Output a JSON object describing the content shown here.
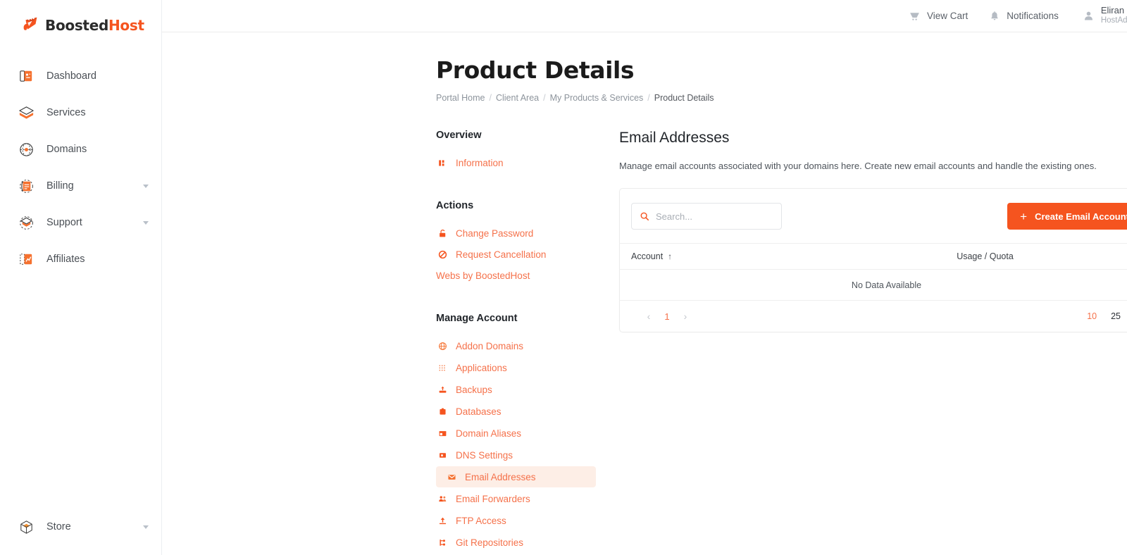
{
  "brand": {
    "name_part1": "Boosted",
    "name_part2": "Host",
    "accent": "#f5541f",
    "accent_light": "#f5714a",
    "highlight_bg": "#fdeee6"
  },
  "sidebar": {
    "items": [
      {
        "label": "Dashboard",
        "icon": "dashboard-icon",
        "caret": false
      },
      {
        "label": "Services",
        "icon": "services-box-icon",
        "caret": false
      },
      {
        "label": "Domains",
        "icon": "domains-globe-icon",
        "caret": false
      },
      {
        "label": "Billing",
        "icon": "billing-icon",
        "caret": true
      },
      {
        "label": "Support",
        "icon": "support-icon",
        "caret": true
      },
      {
        "label": "Affiliates",
        "icon": "affiliates-icon",
        "caret": false
      }
    ],
    "bottom": {
      "label": "Store",
      "icon": "store-cube-icon",
      "caret": true
    }
  },
  "topbar": {
    "cart": {
      "label": "View Cart",
      "icon": "cart-icon"
    },
    "notifications": {
      "label": "Notifications",
      "icon": "bell-icon"
    },
    "user": {
      "name": "Eliran Ouzan",
      "subtitle": "HostAdvice",
      "icon": "user-avatar-icon"
    }
  },
  "page": {
    "title": "Product Details",
    "breadcrumb": [
      "Portal Home",
      "Client Area",
      "My Products & Services",
      "Product Details"
    ],
    "breadcrumb_separator": "/"
  },
  "left_nav": {
    "overview_heading": "Overview",
    "overview_links": [
      {
        "label": "Information",
        "icon": "information-icon"
      }
    ],
    "actions_heading": "Actions",
    "action_links": [
      {
        "label": "Change Password",
        "icon": "lock-icon"
      },
      {
        "label": "Request Cancellation",
        "icon": "no-entry-icon"
      },
      {
        "label": "Webs by BoostedHost",
        "icon": "none"
      }
    ],
    "manage_heading": "Manage Account",
    "manage_links": [
      {
        "label": "Addon Domains",
        "icon": "globe-icon",
        "active": false
      },
      {
        "label": "Applications",
        "icon": "grid-dots-icon",
        "active": false
      },
      {
        "label": "Backups",
        "icon": "backup-icon",
        "active": false
      },
      {
        "label": "Databases",
        "icon": "database-icon",
        "active": false
      },
      {
        "label": "Domain Aliases",
        "icon": "window-icon",
        "active": false
      },
      {
        "label": "DNS Settings",
        "icon": "dns-icon",
        "active": false
      },
      {
        "label": "Email Addresses",
        "icon": "envelope-icon",
        "active": true
      },
      {
        "label": "Email Forwarders",
        "icon": "people-icon",
        "active": false
      },
      {
        "label": "FTP Access",
        "icon": "upload-icon",
        "active": false
      },
      {
        "label": "Git Repositories",
        "icon": "git-branch-icon",
        "active": false
      }
    ]
  },
  "panel": {
    "title": "Email Addresses",
    "description": "Manage email accounts associated with your domains here. Create new email accounts and handle the existing ones.",
    "search": {
      "placeholder": "Search...",
      "value": "",
      "icon": "search-icon"
    },
    "create_button": {
      "label": "Create Email Account",
      "icon": "plus-icon"
    },
    "table": {
      "columns": [
        "Account",
        "Usage / Quota"
      ],
      "sort_column": "Account",
      "sort_direction": "ascending",
      "sort_glyph": "↑",
      "rows": [],
      "empty_message": "No Data Available"
    },
    "pagination": {
      "prev_glyph": "‹",
      "next_glyph": "›",
      "pages": [
        "1"
      ],
      "current_page": "1",
      "page_sizes": [
        "10",
        "25",
        "∞"
      ],
      "selected_page_size": "10"
    }
  }
}
